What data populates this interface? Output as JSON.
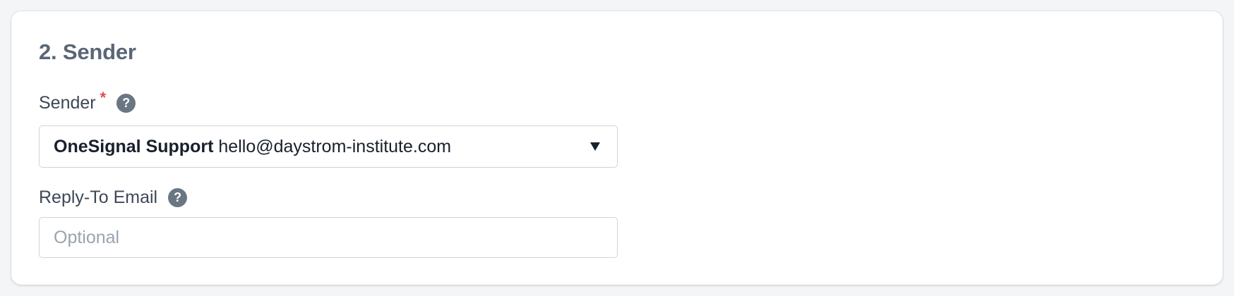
{
  "section": {
    "title": "2. Sender"
  },
  "sender_field": {
    "label": "Sender",
    "required_marker": "*",
    "help_icon": "question-circle-icon",
    "selected_name": "OneSignal Support",
    "selected_email": "hello@daystrom-institute.com",
    "dropdown_icon": "caret-down-icon"
  },
  "reply_to_field": {
    "label": "Reply-To Email",
    "help_icon": "question-circle-icon",
    "value": "",
    "placeholder": "Optional"
  },
  "colors": {
    "required": "#e54b4b",
    "help_icon_bg": "#6b7684",
    "title": "#5b6675"
  }
}
